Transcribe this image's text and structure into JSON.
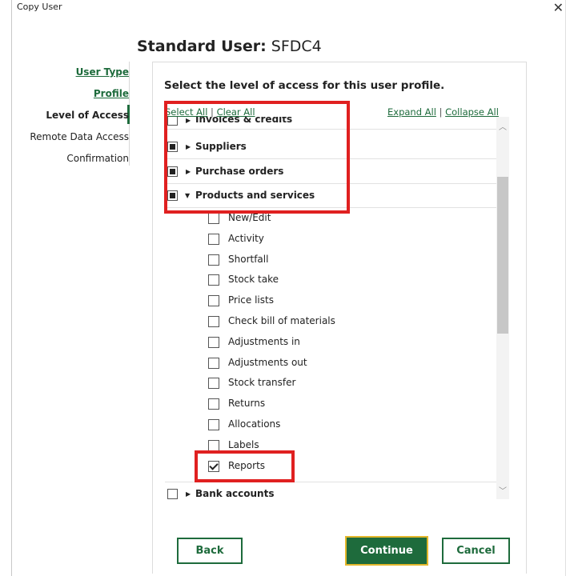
{
  "window": {
    "title": "Copy User",
    "close_icon": "close-icon"
  },
  "dialog": {
    "title_bold": "Standard User:",
    "title_name": "SFDC4"
  },
  "nav": [
    {
      "label": "User Type",
      "state": "link"
    },
    {
      "label": "Profile",
      "state": "link"
    },
    {
      "label": "Level of Access",
      "state": "current"
    },
    {
      "label": "Remote Data Access",
      "state": "plain"
    },
    {
      "label": "Confirmation",
      "state": "plain"
    }
  ],
  "panel": {
    "heading": "Select the level of access for this user profile.",
    "select_all": "Select All",
    "clear_all": "Clear All",
    "expand_all": "Expand All",
    "collapse_all": "Collapse All",
    "separator": "|"
  },
  "list": {
    "cut_off_item": "Invoices & credits",
    "parents": [
      {
        "label": "Suppliers",
        "check": "partial",
        "expanded": false
      },
      {
        "label": "Purchase orders",
        "check": "partial",
        "expanded": false
      },
      {
        "label": "Products and services",
        "check": "partial",
        "expanded": true
      }
    ],
    "children": [
      {
        "label": "New/Edit",
        "checked": false
      },
      {
        "label": "Activity",
        "checked": false
      },
      {
        "label": "Shortfall",
        "checked": false
      },
      {
        "label": "Stock take",
        "checked": false
      },
      {
        "label": "Price lists",
        "checked": false
      },
      {
        "label": "Check bill of materials",
        "checked": false
      },
      {
        "label": "Adjustments in",
        "checked": false
      },
      {
        "label": "Adjustments out",
        "checked": false
      },
      {
        "label": "Stock transfer",
        "checked": false
      },
      {
        "label": "Returns",
        "checked": false
      },
      {
        "label": "Allocations",
        "checked": false
      },
      {
        "label": "Labels",
        "checked": false
      },
      {
        "label": "Reports",
        "checked": true
      }
    ],
    "last_parent": {
      "label": "Bank accounts",
      "check": "none",
      "expanded": false
    }
  },
  "buttons": {
    "back": "Back",
    "continue": "Continue",
    "cancel": "Cancel"
  },
  "colors": {
    "accent": "#1e6b3c",
    "highlight": "#e02020",
    "focus": "#e3b72c"
  }
}
